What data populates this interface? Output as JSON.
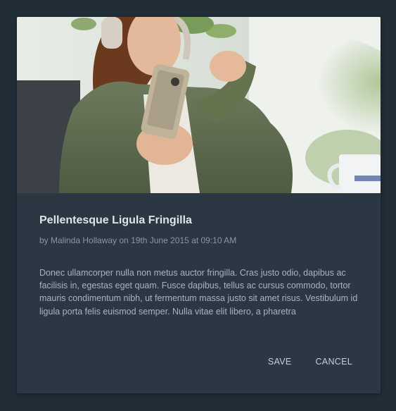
{
  "card": {
    "image_alt": "Woman with headphones holding a smartphone",
    "title": "Pellentesque Ligula Fringilla",
    "meta": "by Malinda Hollaway on 19th June 2015 at 09:10 AM",
    "body": "Donec ullamcorper nulla non metus auctor fringilla. Cras justo odio, dapibus ac facilisis in, egestas eget quam. Fusce dapibus, tellus ac cursus commodo, tortor mauris condimentum nibh, ut fermentum massa justo sit amet risus. Vestibulum id ligula porta felis euismod semper. Nulla vitae elit libero, a pharetra",
    "actions": {
      "save_label": "SAVE",
      "cancel_label": "CANCEL"
    }
  },
  "colors": {
    "page_background": "#212d37",
    "card_background": "#2b3843",
    "title_text": "#dfe4e8",
    "meta_text": "#8a96a0",
    "body_text": "#aab3bb",
    "button_text": "#c8d0d6"
  }
}
